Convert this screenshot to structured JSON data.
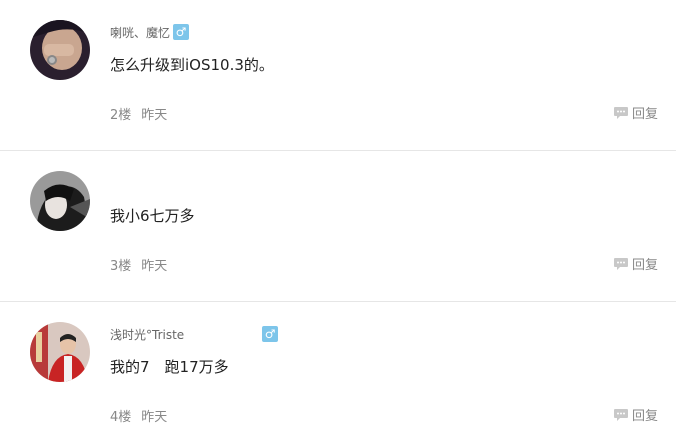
{
  "comments": [
    {
      "username": "喇咣、魔忆",
      "gender_symbol": "♂",
      "content": "怎么升级到iOS10.3的。",
      "floor": "2楼",
      "time": "昨天",
      "reply_label": "回复"
    },
    {
      "username": "",
      "gender_symbol": "",
      "content": "我小6七万多",
      "floor": "3楼",
      "time": "昨天",
      "reply_label": "回复"
    },
    {
      "username": "浅时光°Triste",
      "gender_symbol": "♂",
      "content": "我的7　跑17万多",
      "floor": "4楼",
      "time": "昨天",
      "reply_label": "回复"
    }
  ],
  "colors": {
    "gender_badge": "#7dc5ea",
    "divider": "#e6e6e6",
    "meta_text": "#888888"
  }
}
